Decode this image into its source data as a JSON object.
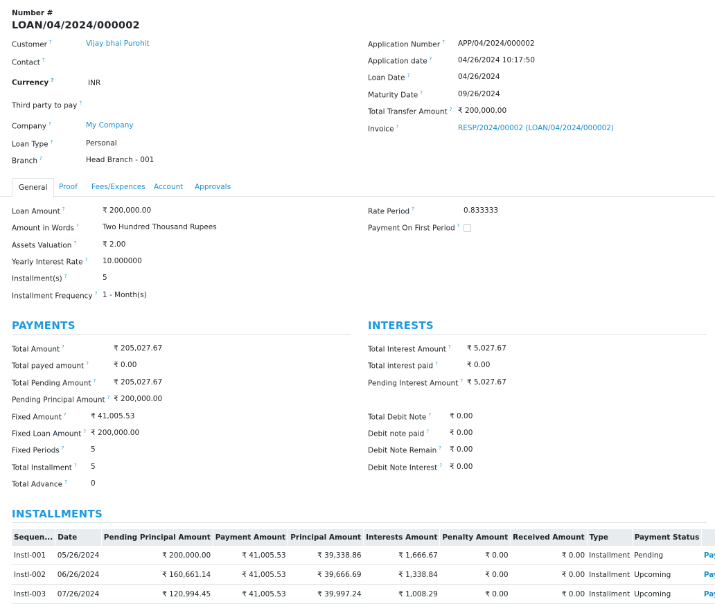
{
  "header": {
    "number_label": "Number #",
    "loan_number": "LOAN/04/2024/000002"
  },
  "left_fields": {
    "customer": {
      "label": "Customer",
      "value": "Vijay bhai Purohit"
    },
    "contact": {
      "label": "Contact",
      "value": ""
    },
    "currency": {
      "label": "Currency",
      "value": "INR"
    },
    "third_party": {
      "label": "Third party to pay",
      "value": ""
    },
    "company": {
      "label": "Company",
      "value": "My Company"
    },
    "loan_type": {
      "label": "Loan Type",
      "value": "Personal"
    },
    "branch": {
      "label": "Branch",
      "value": "Head Branch - 001"
    }
  },
  "right_fields": {
    "application_number": {
      "label": "Application Number",
      "value": "APP/04/2024/000002"
    },
    "application_date": {
      "label": "Application date",
      "value": "04/26/2024 10:17:50"
    },
    "loan_date": {
      "label": "Loan Date",
      "value": "04/26/2024"
    },
    "maturity_date": {
      "label": "Maturity Date",
      "value": "09/26/2024"
    },
    "total_transfer": {
      "label": "Total Transfer Amount",
      "value": "₹ 200,000.00"
    },
    "invoice": {
      "label": "Invoice",
      "value": "RESP/2024/00002 (LOAN/04/2024/000002)"
    }
  },
  "tabs": [
    "General",
    "Proof",
    "Fees/Expences",
    "Account",
    "Approvals"
  ],
  "general": {
    "loan_amount": {
      "label": "Loan Amount",
      "value": "₹ 200,000.00"
    },
    "amount_words": {
      "label": "Amount in Words",
      "value": "Two Hundred Thousand Rupees"
    },
    "assets_valuation": {
      "label": "Assets Valuation",
      "value": "₹ 2.00"
    },
    "yearly_interest": {
      "label": "Yearly Interest Rate",
      "value": "10.000000"
    },
    "installments": {
      "label": "Installment(s)",
      "value": "5"
    },
    "installment_frequency": {
      "label": "Installment Frequency",
      "value": "1 - Month(s)"
    },
    "rate_period": {
      "label": "Rate Period",
      "value": "0.833333"
    },
    "payment_first_period": {
      "label": "Payment On First Period",
      "checked": false
    }
  },
  "payments": {
    "title": "PAYMENTS",
    "total_amount": {
      "label": "Total Amount",
      "value": "₹ 205,027.67"
    },
    "total_payed": {
      "label": "Total payed amount",
      "value": "₹ 0.00"
    },
    "total_pending": {
      "label": "Total Pending Amount",
      "value": "₹ 205,027.67"
    },
    "pending_principal": {
      "label": "Pending Principal Amount",
      "value": "₹ 200,000.00"
    },
    "fixed_amount": {
      "label": "Fixed Amount",
      "value": "₹ 41,005.53"
    },
    "fixed_loan_amount": {
      "label": "Fixed Loan Amount",
      "value": "₹ 200,000.00"
    },
    "fixed_periods": {
      "label": "Fixed Periods",
      "value": "5"
    },
    "total_installment": {
      "label": "Total Installment",
      "value": "5"
    },
    "total_advance": {
      "label": "Total Advance",
      "value": "0"
    }
  },
  "interests": {
    "title": "INTERESTS",
    "total_interest": {
      "label": "Total Interest Amount",
      "value": "₹ 5,027.67"
    },
    "interest_paid": {
      "label": "Total interest paid",
      "value": "₹ 0.00"
    },
    "pending_interest": {
      "label": "Pending Interest Amount",
      "value": "₹ 5,027.67"
    },
    "total_debit_note": {
      "label": "Total Debit Note",
      "value": "₹ 0.00"
    },
    "debit_note_paid": {
      "label": "Debit note paid",
      "value": "₹ 0.00"
    },
    "debit_note_remain": {
      "label": "Debit Note Remain",
      "value": "₹ 0.00"
    },
    "debit_note_interest": {
      "label": "Debit Note Interest",
      "value": "₹ 0.00"
    }
  },
  "installments": {
    "title": "INSTALLMENTS",
    "columns": [
      "Sequen...",
      "Date",
      "Pending Principal Amount",
      "Payment Amount",
      "Principal Amount",
      "Interests Amount",
      "Penalty Amount",
      "Received Amount",
      "Type",
      "Payment Status",
      ""
    ],
    "rows": [
      [
        "Instl-001",
        "05/26/2024",
        "₹ 200,000.00",
        "₹ 41,005.53",
        "₹ 39,338.86",
        "₹ 1,666.67",
        "₹ 0.00",
        "₹ 0.00",
        "Installment",
        "Pending",
        "Payment"
      ],
      [
        "Instl-002",
        "06/26/2024",
        "₹ 160,661.14",
        "₹ 41,005.53",
        "₹ 39,666.69",
        "₹ 1,338.84",
        "₹ 0.00",
        "₹ 0.00",
        "Installment",
        "Upcoming",
        "Payment"
      ],
      [
        "Instl-003",
        "07/26/2024",
        "₹ 120,994.45",
        "₹ 41,005.53",
        "₹ 39,997.24",
        "₹ 1,008.29",
        "₹ 0.00",
        "₹ 0.00",
        "Installment",
        "Upcoming",
        "Payment"
      ]
    ]
  },
  "colors": {
    "accent": "#1a9ae0",
    "link": "#1a8fcf"
  }
}
